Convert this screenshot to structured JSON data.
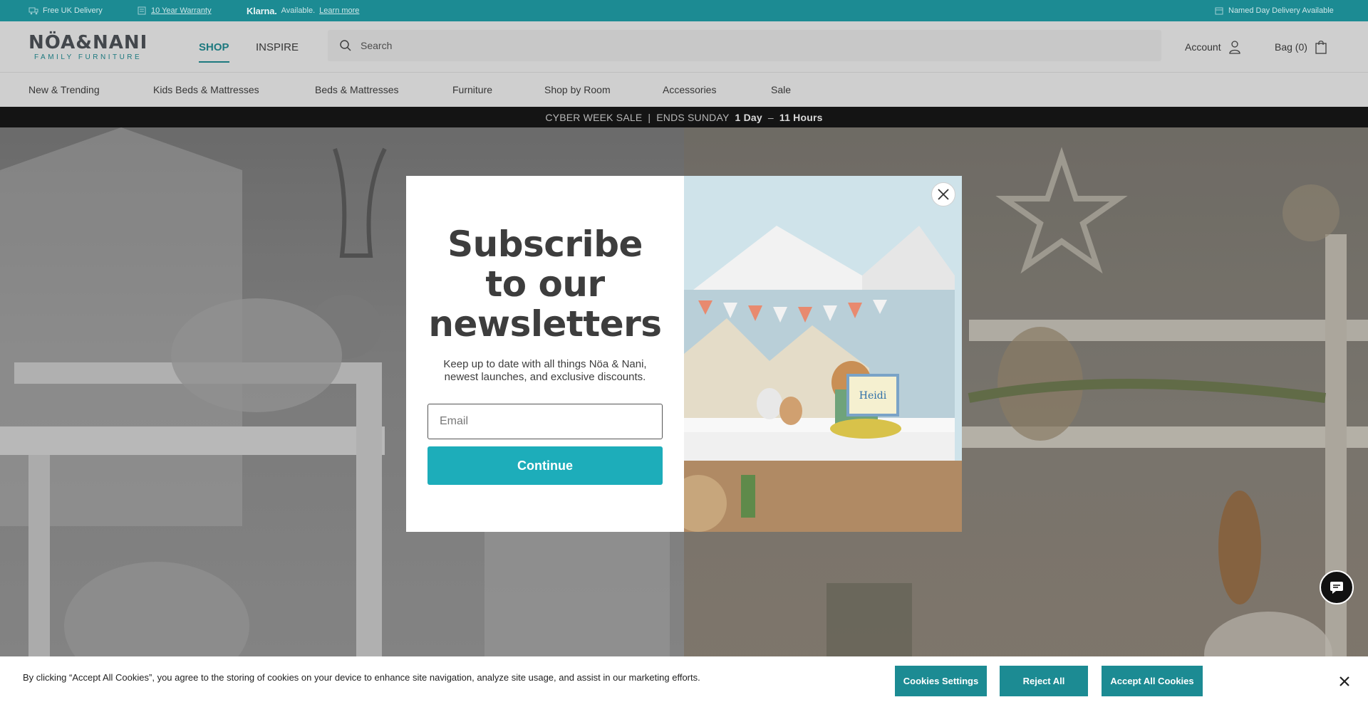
{
  "topbar": {
    "delivery": "Free UK Delivery",
    "warranty": "10 Year Warranty",
    "klarna_brand": "Klarna.",
    "klarna_text": "Available.",
    "klarna_link": "Learn more",
    "named_day": "Named Day Delivery Available"
  },
  "header": {
    "logo_brand": "NÖA&NANI",
    "logo_tag": "FAMILY FURNITURE",
    "nav": [
      "SHOP",
      "INSPIRE"
    ],
    "search_placeholder": "Search",
    "account_label": "Account",
    "bag_label": "Bag (0)"
  },
  "categories": [
    "New & Trending",
    "Kids Beds & Mattresses",
    "Beds & Mattresses",
    "Furniture",
    "Shop by Room",
    "Accessories",
    "Sale"
  ],
  "promo": {
    "text": "CYBER WEEK SALE",
    "separator": "|",
    "ends": "ENDS SUNDAY",
    "days": "1 Day",
    "dash": "–",
    "hours": "11 Hours"
  },
  "modal": {
    "title": "Subscribe to our newsletters",
    "subtitle": "Keep up to date with all things Nöa & Nani, newest launches, and exclusive discounts.",
    "email_placeholder": "Email",
    "continue_label": "Continue",
    "book_title": "Heidi"
  },
  "cookie": {
    "text": "By clicking “Accept All Cookies”, you agree to the storing of cookies on your device to enhance site navigation, analyze site usage, and assist in our marketing efforts.",
    "settings_label": "Cookies Settings",
    "reject_label": "Reject All",
    "accept_label": "Accept All Cookies"
  },
  "colors": {
    "brand_teal": "#1c8b93",
    "cta_teal": "#1dadba",
    "promo_bg": "#111111"
  },
  "icons": [
    "delivery-van-icon",
    "warranty-icon",
    "calendar-icon",
    "search-icon",
    "account-icon",
    "bag-icon",
    "close-icon",
    "chat-icon"
  ]
}
